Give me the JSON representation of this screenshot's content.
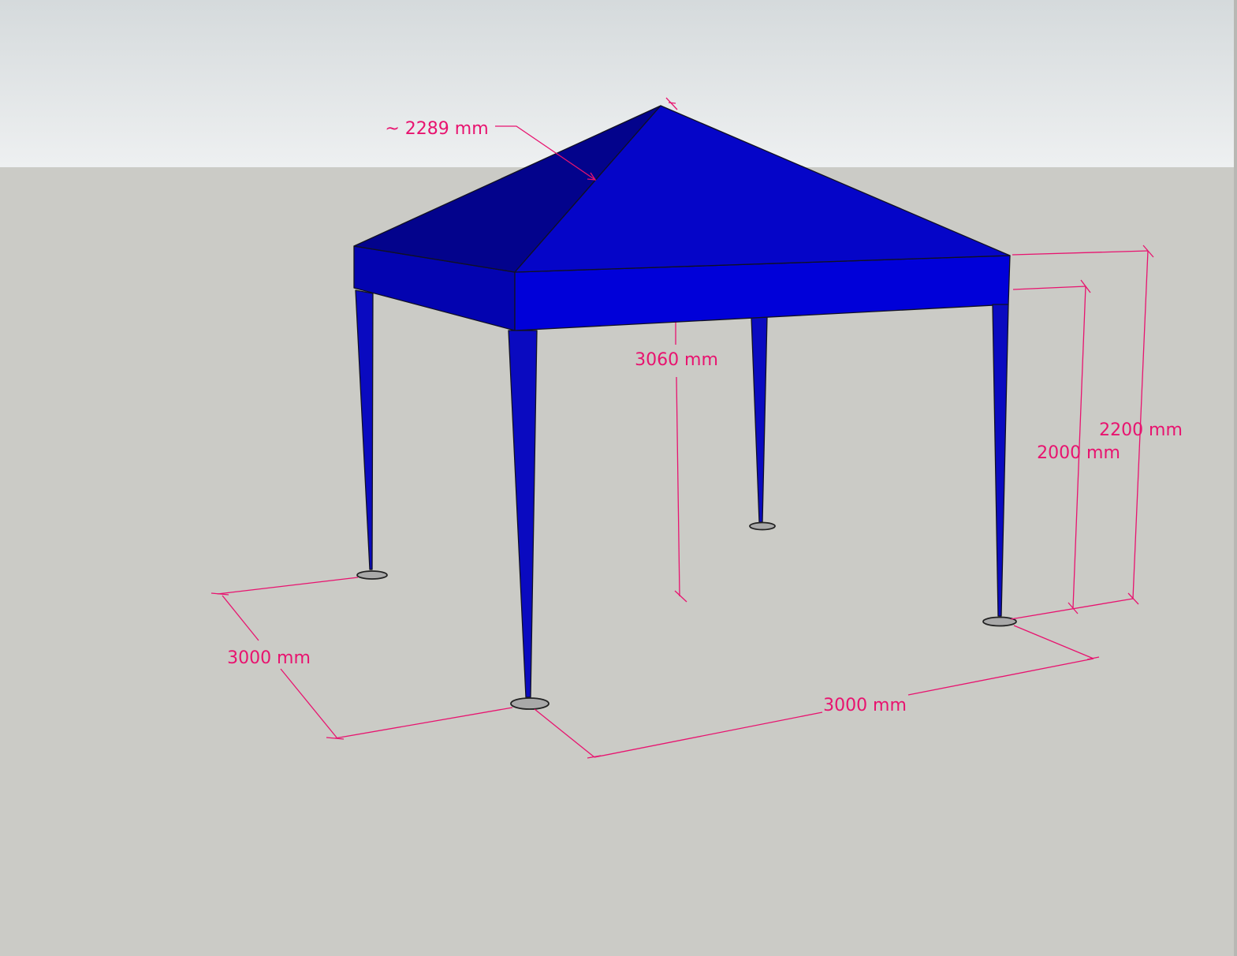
{
  "colors": {
    "sky_top": "#d5dadc",
    "sky_bottom": "#eef0f1",
    "ground": "#cbcbc6",
    "roof_left": "#03038c",
    "roof_front": "#0505c8",
    "skirt_front": "#0000d9",
    "skirt_left": "#0303b0",
    "leg": "#0a0ac0",
    "foot": "#a9a9a9",
    "dimension": "#e8136f",
    "edge": "#111122"
  },
  "dimensions": {
    "roof_slope": "~ 2289 mm",
    "peak_height": "3060 mm",
    "depth": "3000 mm",
    "width": "3000 mm",
    "eave_height": "2000 mm",
    "total_side_height": "2200 mm"
  },
  "icons": {
    "tick": "dimension-tick-icon",
    "arrow": "dimension-arrow-icon"
  }
}
